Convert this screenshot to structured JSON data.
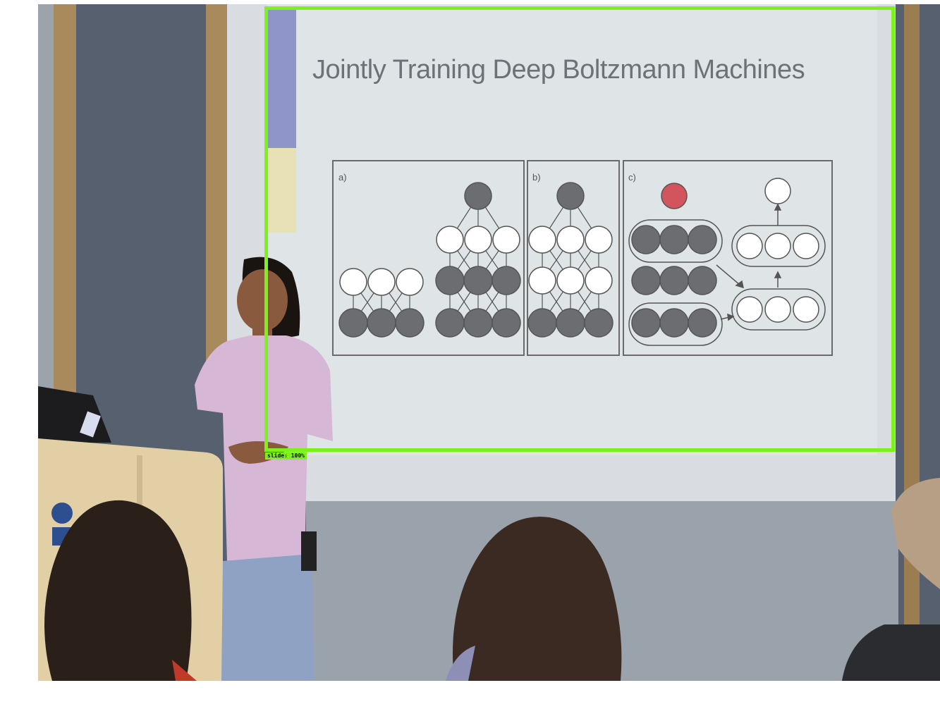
{
  "slide": {
    "title": "Jointly Training Deep Boltzmann Machines",
    "panel_labels": [
      "a)",
      "b)",
      "c)"
    ]
  },
  "detection": {
    "label": "slide: 100%",
    "box_color": "#7cf21a"
  },
  "colors": {
    "filled_node": "#6b6d71",
    "top_node_c": "#d2545c",
    "open_node": "#ffffff",
    "shirt": "#d7b7d6",
    "wall": "#56606e"
  }
}
